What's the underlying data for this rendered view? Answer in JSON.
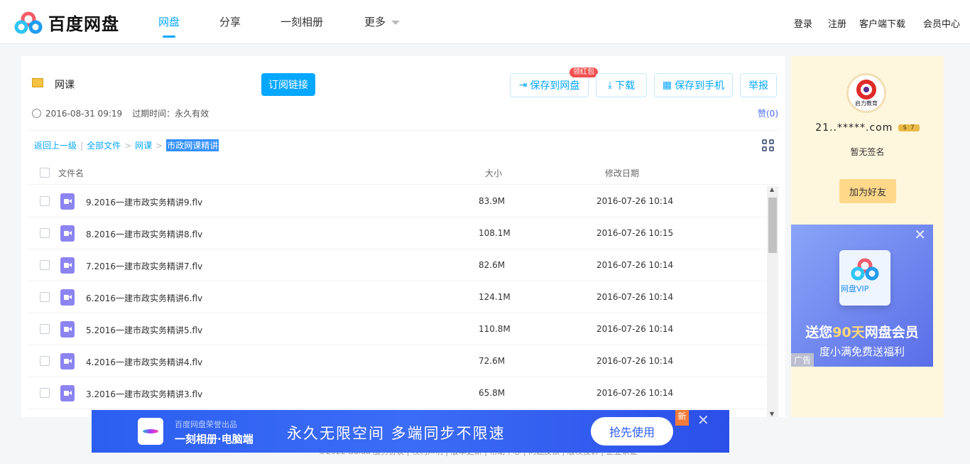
{
  "header": {
    "brand": "百度网盘",
    "nav": [
      "网盘",
      "分享",
      "一刻相册",
      "更多"
    ],
    "right": [
      "登录",
      "注册",
      "客户端下载",
      "会员中心"
    ]
  },
  "share": {
    "folder": "网课",
    "subscribe": "订阅链接",
    "save_disk": "保存到网盘",
    "red_packet": "领红包",
    "download": "下载",
    "save_phone": "保存到手机",
    "report": "举报",
    "time": "2016-08-31 09:19",
    "expire": "过期时间：永久有效",
    "like": "赞(0)"
  },
  "breadcrumb": {
    "back": "返回上一级",
    "all": "全部文件",
    "folder": "网课",
    "current": "市政网课精讲"
  },
  "table": {
    "headers": [
      "文件名",
      "大小",
      "修改日期"
    ],
    "rows": [
      {
        "name": "9.2016一建市政实务精讲9.flv",
        "size": "83.9M",
        "date": "2016-07-26 10:14"
      },
      {
        "name": "8.2016一建市政实务精讲8.flv",
        "size": "108.1M",
        "date": "2016-07-26 10:15"
      },
      {
        "name": "7.2016一建市政实务精讲7.flv",
        "size": "82.6M",
        "date": "2016-07-26 10:14"
      },
      {
        "name": "6.2016一建市政实务精讲6.flv",
        "size": "124.1M",
        "date": "2016-07-26 10:14"
      },
      {
        "name": "5.2016一建市政实务精讲5.flv",
        "size": "110.8M",
        "date": "2016-07-26 10:14"
      },
      {
        "name": "4.2016一建市政实务精讲4.flv",
        "size": "72.6M",
        "date": "2016-07-26 10:14"
      },
      {
        "name": "3.2016一建市政实务精讲3.flv",
        "size": "65.8M",
        "date": "2016-07-26 10:14"
      }
    ]
  },
  "sidebar": {
    "avatar_text": "启力教育",
    "username": "21..*****.com",
    "level": "7",
    "signature": "暂无签名",
    "add_friend": "加为好友"
  },
  "ad": {
    "vip": "网盘VIP",
    "line1_a": "送您",
    "line1_b": "90天",
    "line1_c": "网盘会员",
    "line2": "度小满免费送福利",
    "tag": "广告",
    "close": "✕"
  },
  "banner": {
    "sub": "百度网盘荣誉出品",
    "app": "一刻相册·电脑端",
    "slogan": "永久无限空间  多端同步不限速",
    "cta": "抢先使用",
    "new": "新",
    "close": "✕"
  },
  "footer": "©2022 Baidu 服务协议 | 权利声明 | 版本更新 | 帮助中心 | 问题反馈 | 版权投诉 | 企业认证"
}
